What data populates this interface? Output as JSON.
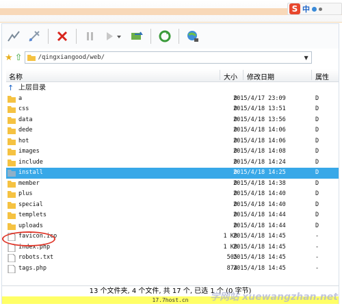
{
  "ime": {
    "label": "中"
  },
  "address": {
    "path": "/qingxiangood/web/"
  },
  "columns": {
    "name": "名称",
    "size": "大小",
    "date": "修改日期",
    "attr": "属性"
  },
  "parent_row": {
    "label": "上层目录"
  },
  "files": [
    {
      "name": "a",
      "size": "0",
      "date": "2015/4/17 23:09",
      "attr": "D",
      "type": "folder"
    },
    {
      "name": "css",
      "size": "0",
      "date": "2015/4/18 13:51",
      "attr": "D",
      "type": "folder"
    },
    {
      "name": "data",
      "size": "0",
      "date": "2015/4/18 13:56",
      "attr": "D",
      "type": "folder"
    },
    {
      "name": "dede",
      "size": "0",
      "date": "2015/4/18 14:06",
      "attr": "D",
      "type": "folder"
    },
    {
      "name": "hot",
      "size": "0",
      "date": "2015/4/18 14:06",
      "attr": "D",
      "type": "folder"
    },
    {
      "name": "images",
      "size": "0",
      "date": "2015/4/18 14:08",
      "attr": "D",
      "type": "folder"
    },
    {
      "name": "include",
      "size": "0",
      "date": "2015/4/18 14:24",
      "attr": "D",
      "type": "folder"
    },
    {
      "name": "install",
      "size": "0",
      "date": "2015/4/18 14:25",
      "attr": "D",
      "type": "folder",
      "selected": true
    },
    {
      "name": "member",
      "size": "0",
      "date": "2015/4/18 14:38",
      "attr": "D",
      "type": "folder"
    },
    {
      "name": "plus",
      "size": "0",
      "date": "2015/4/18 14:40",
      "attr": "D",
      "type": "folder"
    },
    {
      "name": "special",
      "size": "0",
      "date": "2015/4/18 14:40",
      "attr": "D",
      "type": "folder"
    },
    {
      "name": "templets",
      "size": "0",
      "date": "2015/4/18 14:44",
      "attr": "D",
      "type": "folder",
      "circled": true
    },
    {
      "name": "uploads",
      "size": "0",
      "date": "2015/4/18 14:44",
      "attr": "D",
      "type": "folder"
    },
    {
      "name": "favicon.ico",
      "size": "1 KB",
      "date": "2015/4/18 14:45",
      "attr": "-",
      "type": "file"
    },
    {
      "name": "index.php",
      "size": "1 KB",
      "date": "2015/4/18 14:45",
      "attr": "-",
      "type": "file"
    },
    {
      "name": "robots.txt",
      "size": "505",
      "date": "2015/4/18 14:45",
      "attr": "-",
      "type": "file"
    },
    {
      "name": "tags.php",
      "size": "874",
      "date": "2015/4/18 14:45",
      "attr": "-",
      "type": "file"
    }
  ],
  "status": {
    "summary": "13 个文件夹, 4 个文件, 共 17 个, 已选 1 个 (0 字节)",
    "host": "17.7host.cn"
  },
  "watermark": {
    "text": "学网站 xuewangzhan.net"
  },
  "colors": {
    "selection": "#38a8e8",
    "folder": "#f5c242",
    "circle": "#e0392c",
    "status_host_bg": "#ffff66"
  }
}
